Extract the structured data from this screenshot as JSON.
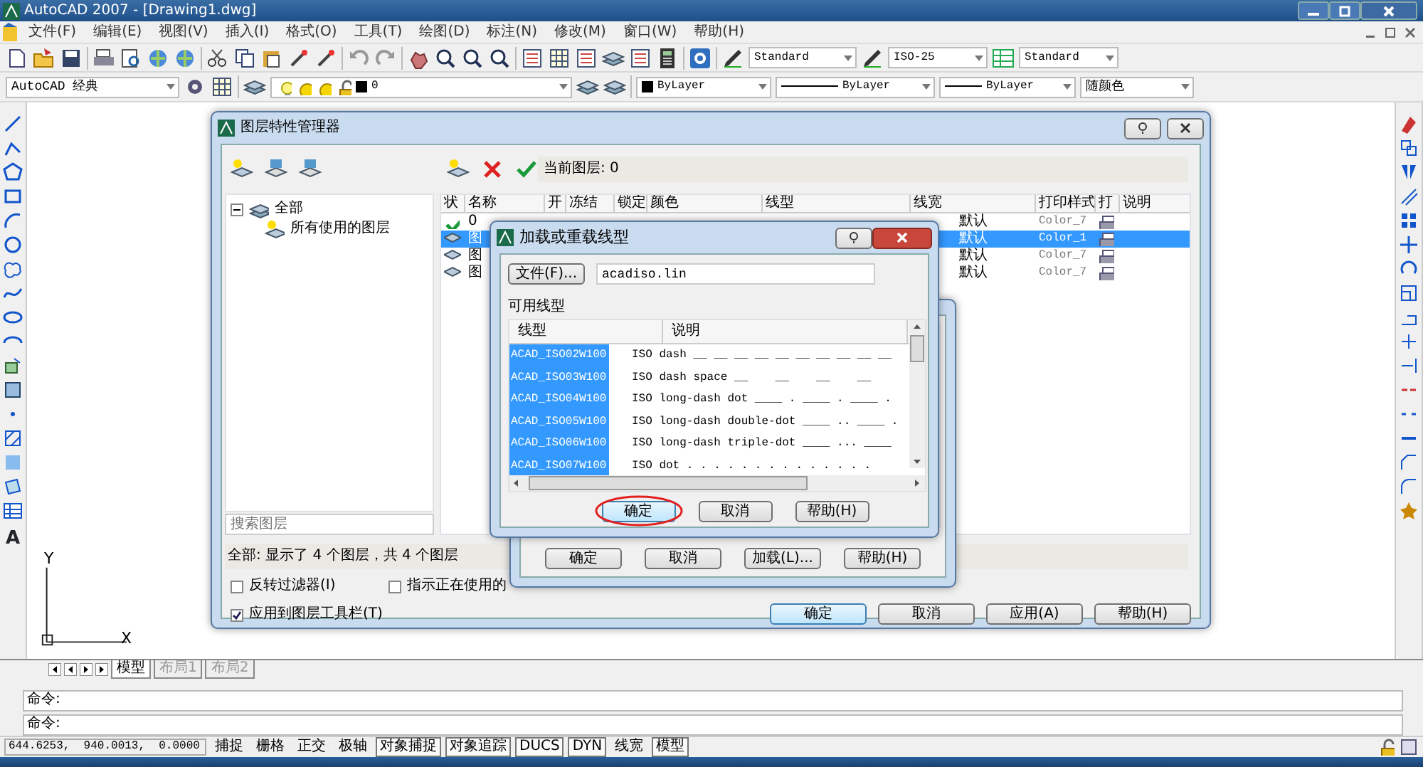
{
  "window": {
    "title": "AutoCAD 2007 - [Drawing1.dwg]"
  },
  "menu": [
    "文件(F)",
    "编辑(E)",
    "视图(V)",
    "插入(I)",
    "格式(O)",
    "工具(T)",
    "绘图(D)",
    "标注(N)",
    "修改(M)",
    "窗口(W)",
    "帮助(H)"
  ],
  "toolbar": {
    "text_style": "Standard",
    "dim_style": "ISO-25",
    "table_style": "Standard",
    "workspace": "AutoCAD 经典",
    "layer": "0",
    "color_control": "ByLayer",
    "linetype": "ByLayer",
    "lineweight": "ByLayer",
    "plot_style": "随颜色"
  },
  "text_tool": "A",
  "ucs": {
    "x_label": "X",
    "y_label": "Y"
  },
  "layout_tabs": [
    {
      "label": "模型",
      "selected": true
    },
    {
      "label": "布局1",
      "selected": false
    },
    {
      "label": "布局2",
      "selected": false
    }
  ],
  "command_lines": [
    "命令:",
    "命令:"
  ],
  "status_bar": {
    "coordinates": "644.6253,  940.0013,  0.0000",
    "toggles": [
      {
        "label": "捕捉",
        "on": false
      },
      {
        "label": "栅格",
        "on": false
      },
      {
        "label": "正交",
        "on": false
      },
      {
        "label": "极轴",
        "on": false
      },
      {
        "label": "对象捕捉",
        "on": true
      },
      {
        "label": "对象追踪",
        "on": true
      },
      {
        "label": "DUCS",
        "on": true
      },
      {
        "label": "DYN",
        "on": true
      },
      {
        "label": "线宽",
        "on": false
      },
      {
        "label": "模型",
        "on": true
      }
    ]
  },
  "layer_manager": {
    "title": "图层特性管理器",
    "current_layer": "当前图层: 0",
    "tree": [
      {
        "label": "全部",
        "expanded": true,
        "children": [
          {
            "label": "所有使用的图层"
          }
        ]
      }
    ],
    "search": {
      "placeholder": "搜索图层"
    },
    "columns": [
      "状",
      "名称",
      "开",
      "冻结",
      "锁定",
      "颜色",
      "线型",
      "线宽",
      "打印样式",
      "打",
      "说明"
    ],
    "rows": [
      {
        "kind": "current",
        "name": "0",
        "lineweight": "默认",
        "plot_style": "Color_7",
        "selected": false
      },
      {
        "kind": "layer",
        "name": "图",
        "lineweight": "默认",
        "plot_style": "Color_1",
        "selected": true
      },
      {
        "kind": "layer",
        "name": "图",
        "lineweight": "默认",
        "plot_style": "Color_7",
        "selected": false
      },
      {
        "kind": "layer",
        "name": "图",
        "lineweight": "默认",
        "plot_style": "Color_7",
        "selected": false
      }
    ],
    "summary": "全部: 显示了 4 个图层，共 4 个图层",
    "options": [
      {
        "label": "反转过滤器(I)",
        "checked": false
      },
      {
        "label": "指示正在使用的",
        "checked": false
      },
      {
        "label": "应用到图层工具栏(T)",
        "checked": true
      }
    ],
    "buttons": [
      {
        "label": "确定",
        "default": true
      },
      {
        "label": "取消",
        "default": false
      },
      {
        "label": "应用(A)",
        "default": false
      },
      {
        "label": "帮助(H)",
        "default": false
      }
    ]
  },
  "select_linetype_dialog": {
    "buttons": [
      "确定",
      "取消",
      "加载(L)...",
      "帮助(H)"
    ]
  },
  "load_linetype_dialog": {
    "title": "加载或重载线型",
    "file_button": "文件(F)...",
    "file": "acadiso.lin",
    "list_label": "可用线型",
    "columns": [
      "线型",
      "说明"
    ],
    "rows": [
      {
        "name": "ACAD_ISO02W100",
        "description": "ISO dash __ __ __ __ __ __ __ __ __ __",
        "selected": true
      },
      {
        "name": "ACAD_ISO03W100",
        "description": "ISO dash space __    __    __    __",
        "selected": true
      },
      {
        "name": "ACAD_ISO04W100",
        "description": "ISO long-dash dot ____ . ____ . ____ .",
        "selected": true
      },
      {
        "name": "ACAD_ISO05W100",
        "description": "ISO long-dash double-dot ____ .. ____ .",
        "selected": true
      },
      {
        "name": "ACAD_ISO06W100",
        "description": "ISO long-dash triple-dot ____ ... ____",
        "selected": true
      },
      {
        "name": "ACAD_ISO07W100",
        "description": "ISO dot . . . . . . . . . . . . . .",
        "selected": true
      }
    ],
    "buttons": [
      {
        "label": "确定",
        "highlighted": true
      },
      {
        "label": "取消",
        "highlighted": false
      },
      {
        "label": "帮助(H)",
        "highlighted": false
      }
    ]
  }
}
